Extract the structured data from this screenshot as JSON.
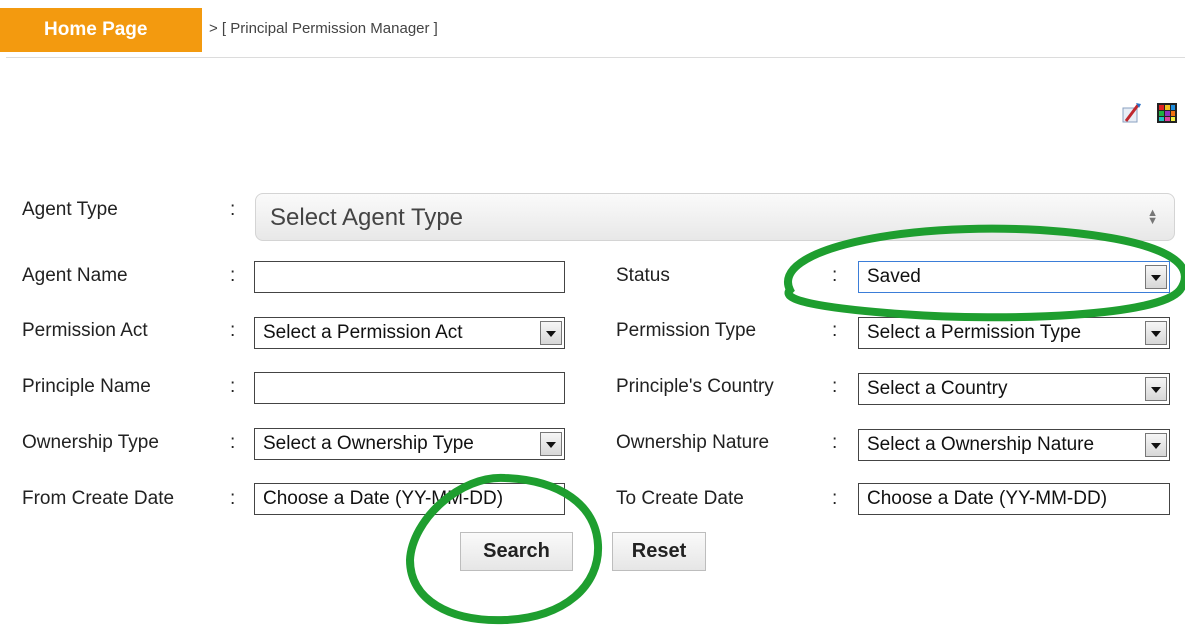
{
  "header": {
    "home_label": "Home Page",
    "breadcrumb": "> [ Principal Permission Manager ]"
  },
  "toolbar": {
    "icons": [
      "edit-icon",
      "color-grid-icon"
    ]
  },
  "form": {
    "agent_type": {
      "label": "Agent Type",
      "placeholder": "Select Agent Type"
    },
    "agent_name": {
      "label": "Agent Name",
      "value": ""
    },
    "status": {
      "label": "Status",
      "value": "Saved"
    },
    "permission_act": {
      "label": "Permission Act",
      "value": "Select a Permission Act"
    },
    "permission_type": {
      "label": "Permission Type",
      "value": "Select a Permission Type"
    },
    "principle_name": {
      "label": "Principle Name",
      "value": ""
    },
    "principle_country": {
      "label": "Principle's Country",
      "value": "Select a Country"
    },
    "ownership_type": {
      "label": "Ownership Type",
      "value": "Select a Ownership Type"
    },
    "ownership_nature": {
      "label": "Ownership Nature",
      "value": "Select a Ownership Nature"
    },
    "from_create_date": {
      "label": "From Create Date",
      "value": "Choose a Date (YY-MM-DD)"
    },
    "to_create_date": {
      "label": "To Create Date",
      "value": "Choose a Date (YY-MM-DD)"
    },
    "colon": ":"
  },
  "actions": {
    "search_label": "Search",
    "reset_label": "Reset"
  },
  "colors": {
    "home_button": "#f39a0f",
    "annotation": "#1e9e2f",
    "focused_border": "#3b7dd8"
  }
}
